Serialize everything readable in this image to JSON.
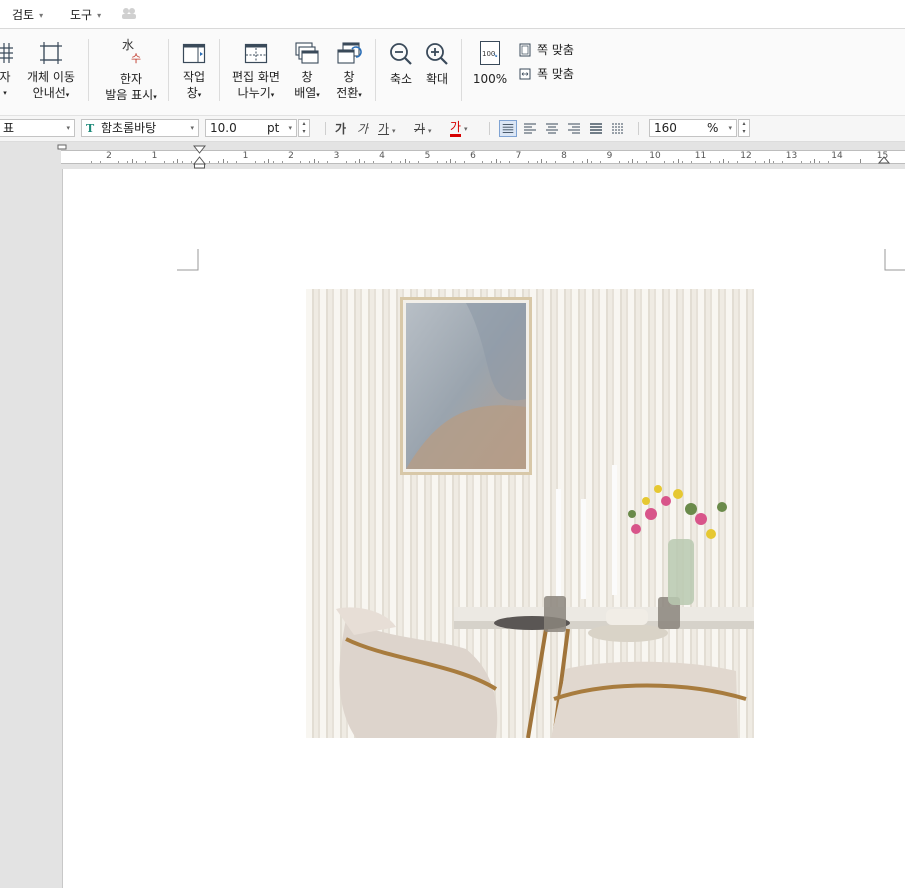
{
  "menubar": {
    "items": [
      {
        "label": "검토"
      },
      {
        "label": "도구"
      }
    ]
  },
  "ribbon": {
    "partial_grid_label1": "자",
    "move_guide": {
      "line1": "개체 이동",
      "line2": "안내선"
    },
    "hanja": {
      "glyph_top": "水",
      "glyph_bottom": "수",
      "line1": "한자",
      "line2": "발음 표시"
    },
    "work_window": {
      "line1": "작업",
      "line2": "창"
    },
    "split_view": {
      "line1": "편집 화면",
      "line2": "나누기"
    },
    "window_arrange": {
      "line1": "창",
      "line2": "배열"
    },
    "window_switch": {
      "line1": "창",
      "line2": "전환"
    },
    "zoom_out": "축소",
    "zoom_in": "확대",
    "zoom_100": {
      "icon_text": "100",
      "label": "100%"
    },
    "fit_page": "쪽 맞춤",
    "fit_width": "폭 맞춤"
  },
  "format_bar": {
    "style_value": "표",
    "font_value": "함초롬바탕",
    "size_value": "10.0",
    "size_unit": "pt",
    "bold": "가",
    "italic": "가",
    "underline": "가",
    "strike": "가",
    "color_char": "가",
    "line_spacing_value": "160",
    "line_spacing_unit": "%"
  },
  "ruler": {
    "labels": [
      "2",
      "1",
      "1",
      "2",
      "3",
      "4",
      "5",
      "6",
      "7",
      "8",
      "9",
      "10",
      "11",
      "12",
      "13",
      "14",
      "15"
    ]
  },
  "colors": {
    "workspace_bg": "#e3e3e3",
    "text_color_red": "#d60000",
    "active_align": "#dbe6f5"
  }
}
